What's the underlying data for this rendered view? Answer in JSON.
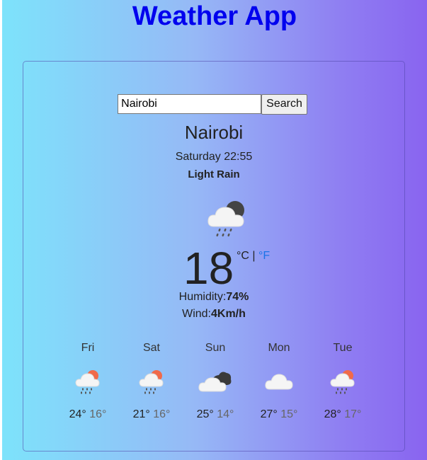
{
  "app": {
    "title": "Weather App"
  },
  "search": {
    "value": "Nairobi",
    "button_label": "Search"
  },
  "current": {
    "city": "Nairobi",
    "datetime": "Saturday 22:55",
    "description": "Light Rain",
    "icon": "cloud-rain-moon-icon",
    "temperature": "18",
    "unit_celsius": "°C",
    "unit_separator": "|",
    "unit_fahrenheit": "°F",
    "humidity_label": "Humidity:",
    "humidity_value": "74%",
    "wind_label": "Wind:",
    "wind_value": "4Km/h"
  },
  "colors": {
    "title": "#0000ee",
    "link": "#1a73e8",
    "sun": "#f06a4a"
  },
  "forecast": [
    {
      "day": "Fri",
      "icon": "cloud-rain-sun-icon",
      "max": "24°",
      "min": "16°"
    },
    {
      "day": "Sat",
      "icon": "cloud-rain-sun-icon",
      "max": "21°",
      "min": "16°"
    },
    {
      "day": "Sun",
      "icon": "broken-clouds-icon",
      "max": "25°",
      "min": "14°"
    },
    {
      "day": "Mon",
      "icon": "cloud-icon",
      "max": "27°",
      "min": "15°"
    },
    {
      "day": "Tue",
      "icon": "cloud-rain-sun-icon",
      "max": "28°",
      "min": "17°"
    }
  ]
}
